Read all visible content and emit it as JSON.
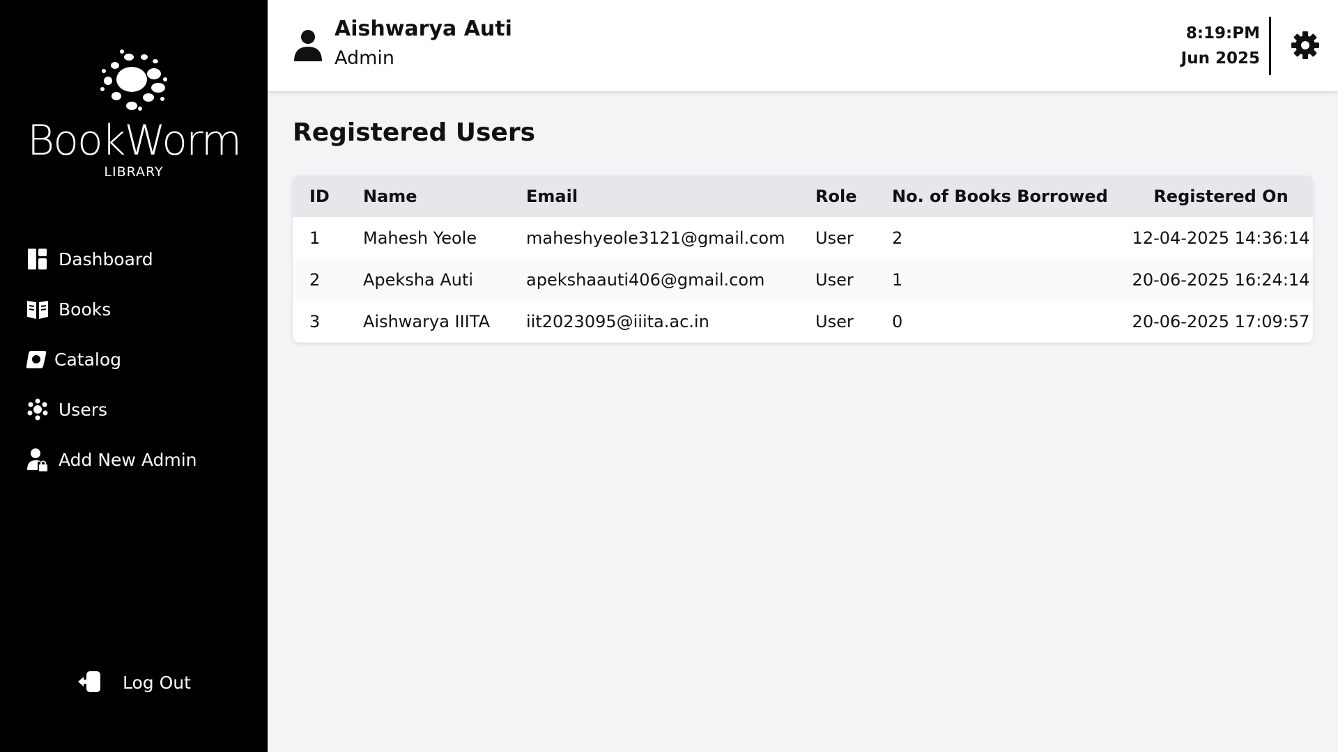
{
  "brand": {
    "name": "BookWorm",
    "subtitle": "LIBRARY"
  },
  "sidebar": {
    "items": [
      {
        "label": "Dashboard",
        "icon": "dashboard-icon"
      },
      {
        "label": "Books",
        "icon": "book-icon"
      },
      {
        "label": "Catalog",
        "icon": "catalog-icon"
      },
      {
        "label": "Users",
        "icon": "users-icon"
      },
      {
        "label": "Add New Admin",
        "icon": "add-admin-icon"
      }
    ],
    "logout_label": "Log Out"
  },
  "header": {
    "user_name": "Aishwarya Auti",
    "user_role": "Admin",
    "time": "8:19:PM",
    "date": "Jun 2025"
  },
  "main": {
    "title": "Registered Users",
    "table": {
      "columns": [
        "ID",
        "Name",
        "Email",
        "Role",
        "No. of Books Borrowed",
        "Registered On"
      ],
      "rows": [
        {
          "id": "1",
          "name": "Mahesh Yeole",
          "email": "maheshyeole3121@gmail.com",
          "role": "User",
          "borrowed": "2",
          "registered": "12-04-2025 14:36:14"
        },
        {
          "id": "2",
          "name": "Apeksha Auti",
          "email": "apekshaauti406@gmail.com",
          "role": "User",
          "borrowed": "1",
          "registered": "20-06-2025 16:24:14"
        },
        {
          "id": "3",
          "name": "Aishwarya IIITA",
          "email": "iit2023095@iiita.ac.in",
          "role": "User",
          "borrowed": "0",
          "registered": "20-06-2025 17:09:57"
        }
      ]
    }
  },
  "colors": {
    "sidebar_bg": "#000000",
    "page_bg": "#f3f4f6",
    "header_bg": "#ffffff",
    "table_head_bg": "#e5e7eb"
  }
}
